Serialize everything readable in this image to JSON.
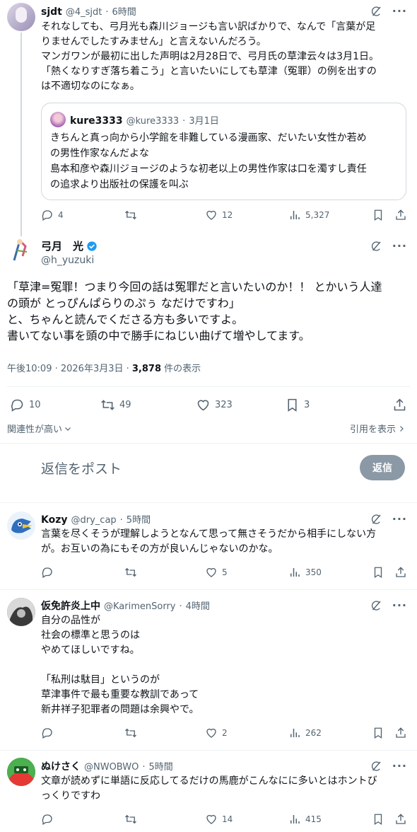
{
  "tweet1": {
    "name": "sjdt",
    "handle": "@4_sjdt",
    "time": "6時間",
    "text": "それなしても、弓月光も森川ジョージも言い訳ばかりで、なんで「言葉が足\nりませんでしたすみません」と言えないんだろう。\nマンガワンが最初に出した声明は2月28日で、弓月氏の草津云々は3月1日。\n「熱くなりすぎ落ち着こう」と言いたいにしても草津（冤罪）の例を出すの\nは不適切なのになぁ。",
    "quote": {
      "name": "kure3333",
      "handle": "@kure3333",
      "time": "3月1日",
      "text": "きちんと真っ向から小学館を非難している漫画家、だいたい女性か若め\nの男性作家なんだよな\n島本和彦や森川ジョージのような初老以上の男性作家は口を濁すし責任\nの追求より出版社の保護を叫ぶ"
    },
    "replies": "4",
    "retweets": "",
    "likes": "12",
    "views": "5,327"
  },
  "main": {
    "name": "弓月　光",
    "handle": "@h_yuzuki",
    "text": "「草津=冤罪！つまり今回の話は冤罪だと言いたいのか！！ とかいう人達\nの頭が とっぴんぱらりのぷぅ なだけですわ」\nと、ちゃんと読んでくださる方も多いですよ。\n書いてない事を頭の中で勝手にねじい曲げて増やしてます。",
    "timestamp": "午後10:09 · 2026年3月3日 · ",
    "views_count": "3,878",
    "views_label": " 件の表示",
    "replies": "10",
    "retweets": "49",
    "likes": "323",
    "bookmarks": "3",
    "sort_label": "関連性が高い",
    "quotes_label": "引用を表示"
  },
  "compose": {
    "placeholder": "返信をポスト",
    "button": "返信"
  },
  "reply1": {
    "name": "Kozy",
    "handle": "@dry_cap",
    "time": "5時間",
    "text": "言葉を尽くそうが理解しようとなんて思って無さそうだから相手にしない方\nが。お互いの為にもその方が良いんじゃないのかな。",
    "replies": "",
    "retweets": "",
    "likes": "5",
    "views": "350"
  },
  "reply2": {
    "name": "仮免許炎上中",
    "handle": "@KarimenSorry",
    "time": "4時間",
    "text": "自分の品性が\n社会の標準と思うのは\nやめてほしいですね。\n\n「私刑は駄目」というのが\n草津事件で最も重要な教訓であって\n新井祥子犯罪者の問題は余興やで。",
    "replies": "",
    "retweets": "",
    "likes": "2",
    "views": "262"
  },
  "reply3": {
    "name": "ぬけさく",
    "handle": "@NWOBWO",
    "time": "5時間",
    "text": "文章が読めずに単語に反応してるだけの馬鹿がこんなにに多いとはホントび\nっくりですわ",
    "replies": "",
    "retweets": "",
    "likes": "14",
    "views": "415"
  },
  "colors": {
    "accent": "#1d9bf0",
    "secondary_text": "#536471",
    "divider": "#eff3f4",
    "reply_button": "#8b98a5"
  }
}
